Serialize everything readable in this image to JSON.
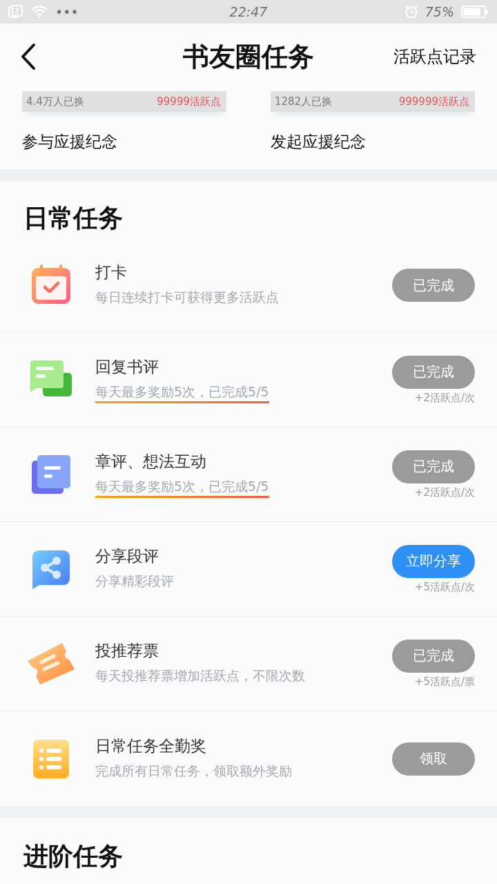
{
  "status_bar": {
    "dots": "•••",
    "time": "22:47",
    "battery_percent": "75%"
  },
  "header": {
    "title": "书友圈任务",
    "action": "活跃点记录"
  },
  "badges": [
    {
      "exchanged": "4.4万人已换",
      "price": "99999活跃点",
      "name": "参与应援纪念"
    },
    {
      "exchanged": "1282人已换",
      "price": "999999活跃点",
      "name": "发起应援纪念"
    }
  ],
  "daily_section": {
    "title": "日常任务"
  },
  "tasks": [
    {
      "kind": "calendar",
      "title": "打卡",
      "description": "每日连续打卡可获得更多活跃点",
      "highlighted": false,
      "button": "已完成",
      "enabled": false
    },
    {
      "kind": "chat",
      "title": "回复书评",
      "description": "每天最多奖励5次，已完成5/5",
      "highlighted": true,
      "button": "已完成",
      "enabled": false,
      "reward": "+2活跃点/次"
    },
    {
      "kind": "docs",
      "title": "章评、想法互动",
      "description": "每天最多奖励5次，已完成5/5",
      "highlighted": true,
      "button": "已完成",
      "enabled": false,
      "reward": "+2活跃点/次"
    },
    {
      "kind": "share",
      "title": "分享段评",
      "description": "分享精彩段评",
      "highlighted": false,
      "button": "立即分享",
      "enabled": true,
      "reward": "+5活跃点/次"
    },
    {
      "kind": "ticket",
      "title": "投推荐票",
      "description": "每天投推荐票增加活跃点，不限次数",
      "highlighted": false,
      "button": "已完成",
      "enabled": false,
      "reward": "+5活跃点/票"
    },
    {
      "kind": "list",
      "title": "日常任务全勤奖",
      "description": "完成所有日常任务，领取额外奖励",
      "highlighted": false,
      "button": "领取",
      "enabled": false
    }
  ],
  "advanced_section": {
    "title": "进阶任务"
  }
}
